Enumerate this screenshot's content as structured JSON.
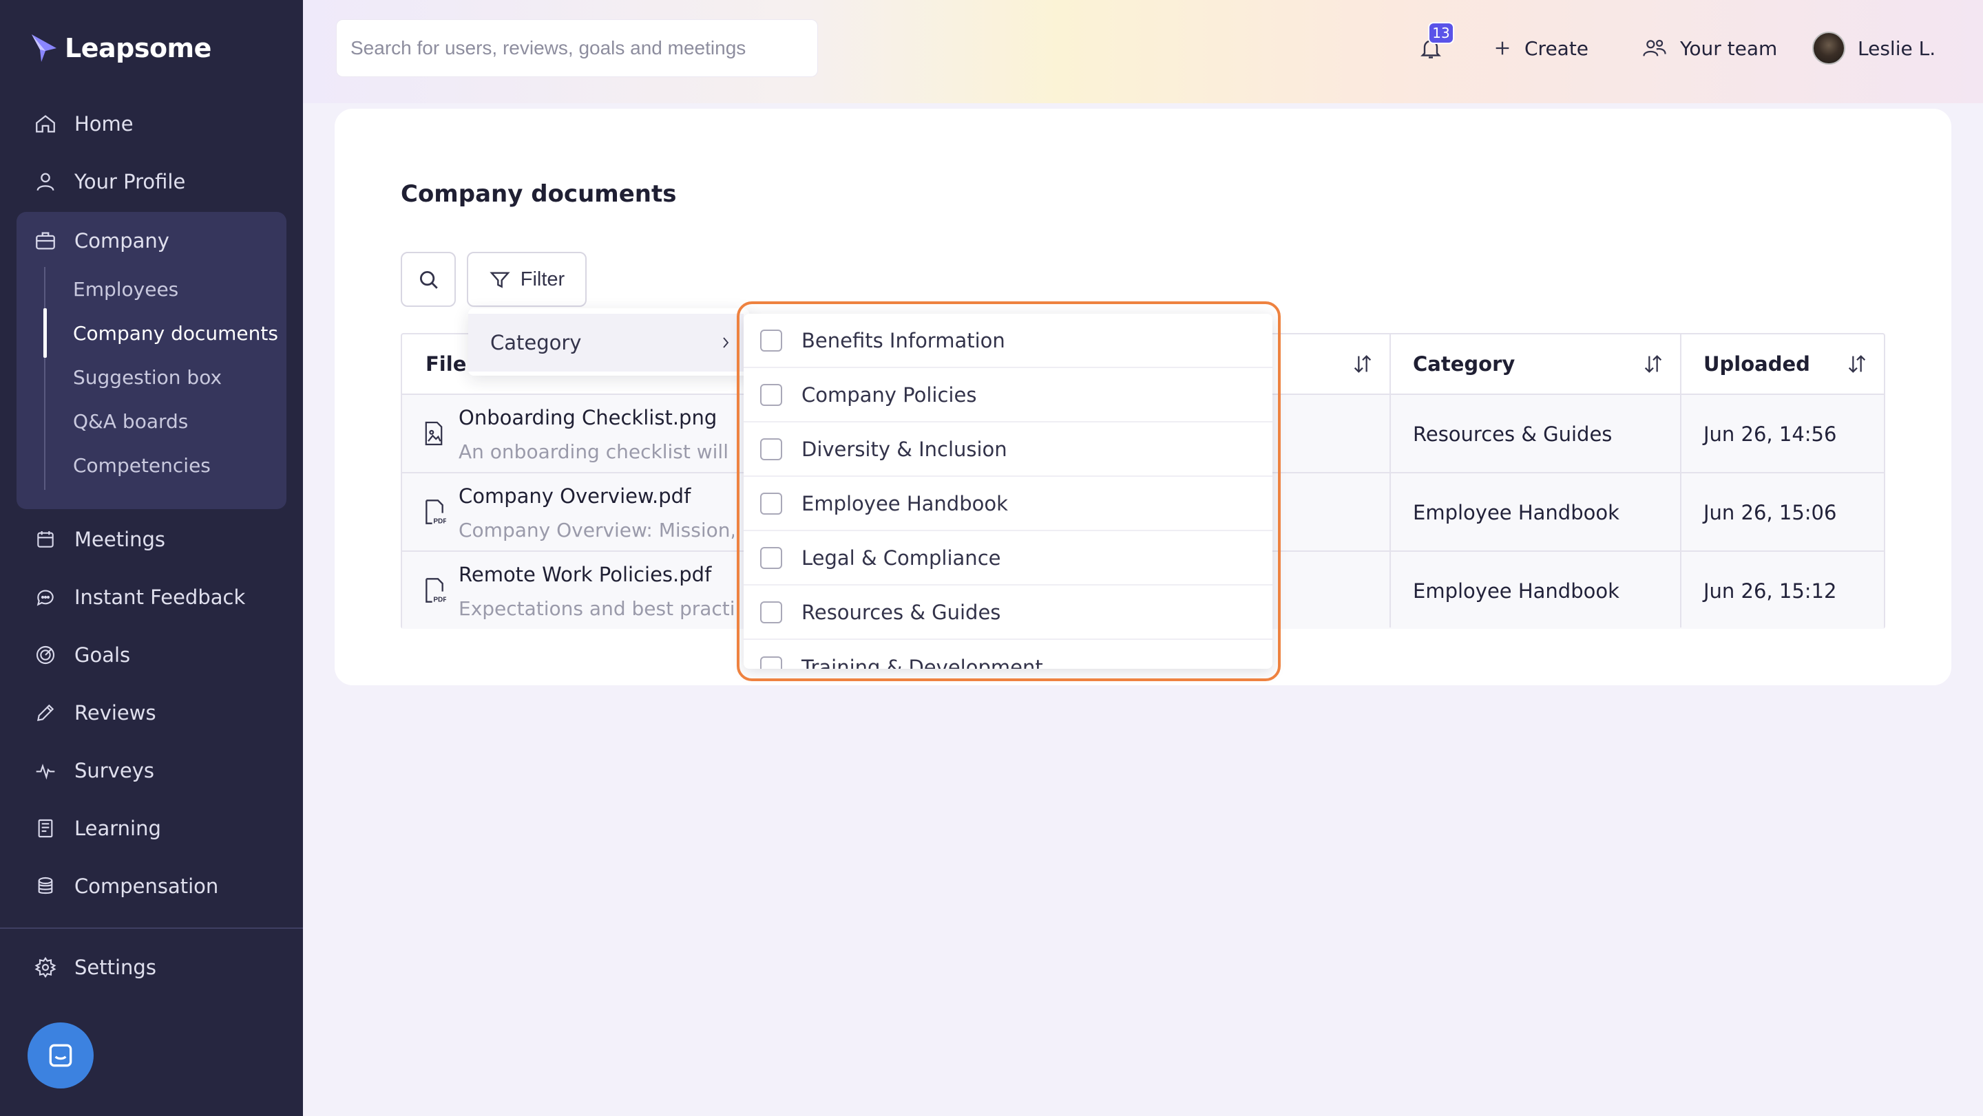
{
  "app": {
    "brand": "Leapsome",
    "accent": "#5a53e8",
    "sidebar_bg": "#262640",
    "highlight": "#ee8240"
  },
  "sidebar": {
    "home": "Home",
    "profile": "Your Profile",
    "company": "Company",
    "company_sub": [
      "Employees",
      "Company documents",
      "Suggestion box",
      "Q&A boards",
      "Competencies"
    ],
    "meetings": "Meetings",
    "feedback": "Instant Feedback",
    "goals": "Goals",
    "reviews": "Reviews",
    "surveys": "Surveys",
    "learning": "Learning",
    "compensation": "Compensation",
    "settings": "Settings"
  },
  "topbar": {
    "search_placeholder": "Search for users, reviews, goals and meetings",
    "notifications": "13",
    "create": "Create",
    "team": "Your team",
    "user": "Leslie L."
  },
  "page": {
    "title": "Company documents",
    "filter": "Filter",
    "columns": {
      "file": "File name",
      "category": "Category",
      "uploaded": "Uploaded"
    },
    "rows": [
      {
        "name": "Onboarding Checklist.png",
        "desc": "An onboarding checklist will ensure",
        "category": "Resources & Guides",
        "uploaded": "Jun 26, 14:56",
        "icon": "image-file-icon"
      },
      {
        "name": "Company Overview.pdf",
        "desc": "Company Overview: Mission, Vision",
        "category": "Employee Handbook",
        "uploaded": "Jun 26, 15:06",
        "icon": "pdf-file-icon"
      },
      {
        "name": "Remote Work Policies.pdf",
        "desc": "Expectations and best practices",
        "category": "Employee Handbook",
        "uploaded": "Jun 26, 15:12",
        "icon": "pdf-file-icon"
      }
    ]
  },
  "filter_menu": {
    "category": "Category",
    "options": [
      "Benefits Information",
      "Company Policies",
      "Diversity & Inclusion",
      "Employee Handbook",
      "Legal & Compliance",
      "Resources & Guides",
      "Training & Development"
    ]
  }
}
